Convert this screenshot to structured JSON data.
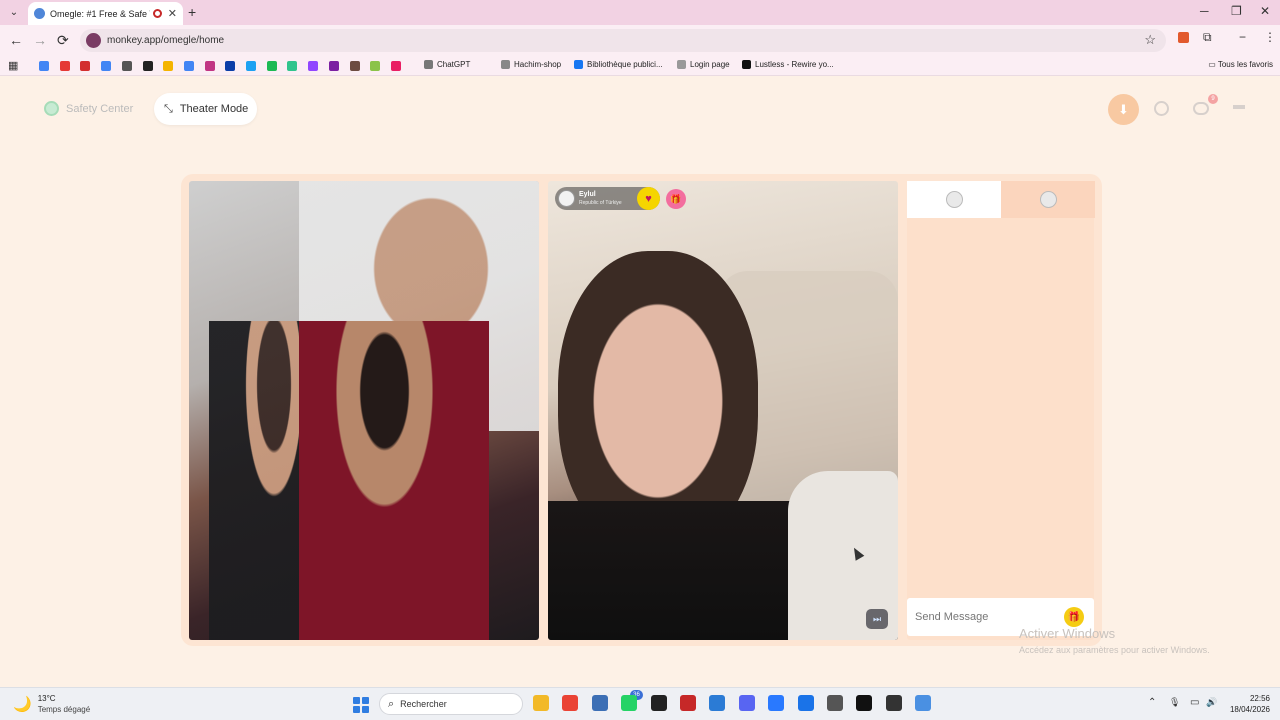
{
  "browser": {
    "tab_title": "Omegle: #1 Free & Safe Vid",
    "tab_close": "✕",
    "tab_menu": "⌄",
    "new_tab": "+",
    "url": "monkey.app/omegle/home",
    "window_controls": {
      "minimize": "─",
      "restore": "❐",
      "close": "✕"
    },
    "nav": {
      "back": "←",
      "forward": "→",
      "reload": "⟳"
    },
    "star": "☆",
    "extensions": {
      "profile": "−",
      "menu": "⋮",
      "puzzle": "⧉"
    },
    "bookmarks": [
      {
        "label": "ChatGPT",
        "color": "#777777"
      },
      {
        "label": "Hachim-shop",
        "color": "#888888"
      },
      {
        "label": "Bibliothèque publici...",
        "color": "#1877f2"
      },
      {
        "label": "Login page",
        "color": "#999999"
      },
      {
        "label": "Lustless - Rewire yo...",
        "color": "#111111"
      }
    ],
    "bookmark_icon_colors": [
      "#4285f4",
      "#e53935",
      "#d32f2f",
      "#4285f4",
      "#555555",
      "#222222",
      "#f4b400",
      "#4285f4",
      "#c13584",
      "#0b3ea8",
      "#1da1f2",
      "#1db954",
      "#31c48d",
      "#9146ff",
      "#7b1fa2",
      "#6d4c41",
      "#8bc34a",
      "#e91e63"
    ],
    "all_bookmarks": "Tous les favoris"
  },
  "page": {
    "safety_center": "Safety Center",
    "theater_mode": "Theater Mode",
    "theater_icon": "⤡",
    "download_icon": "⬇",
    "chat_badge_count": "9"
  },
  "remote_user": {
    "name": "Eylul",
    "country": "Republic of Türkiye",
    "heart_icon": "♥",
    "gift_icon": "🎁",
    "skip_icon": "⏭"
  },
  "chat": {
    "send_placeholder": "Send Message",
    "gift_icon": "🎁"
  },
  "windows_watermark": {
    "title": "Activer Windows",
    "subtitle": "Accédez aux paramètres pour activer Windows."
  },
  "taskbar": {
    "temperature": "13°C",
    "condition": "Temps dégagé",
    "weather_icon": "🌙",
    "search_placeholder": "Rechercher",
    "search_icon": "⌕",
    "whatsapp_badge": "36",
    "apps": [
      {
        "name": "files-icon",
        "color": "#f2b928"
      },
      {
        "name": "chrome-icon",
        "color": "#ea4335"
      },
      {
        "name": "calculator-icon",
        "color": "#3c6fb5"
      },
      {
        "name": "whatsapp-icon",
        "color": "#25d366"
      },
      {
        "name": "capcut-icon",
        "color": "#222222"
      },
      {
        "name": "app-red-icon",
        "color": "#c62828"
      },
      {
        "name": "vscode-icon",
        "color": "#2b7bd5"
      },
      {
        "name": "discord-icon",
        "color": "#5865f2"
      },
      {
        "name": "arc-icon",
        "color": "#2979ff"
      },
      {
        "name": "edge-icon",
        "color": "#1a73e8"
      },
      {
        "name": "snipping-icon",
        "color": "#555555"
      },
      {
        "name": "notion-icon",
        "color": "#111111"
      },
      {
        "name": "obs-icon",
        "color": "#333333"
      },
      {
        "name": "monkey-icon",
        "color": "#4a90e2"
      }
    ],
    "tray": {
      "chevron": "⌃",
      "mic": "🎙",
      "display": "▭",
      "volume": "🔊"
    },
    "time": "22:56",
    "date": "18/04/2026"
  }
}
